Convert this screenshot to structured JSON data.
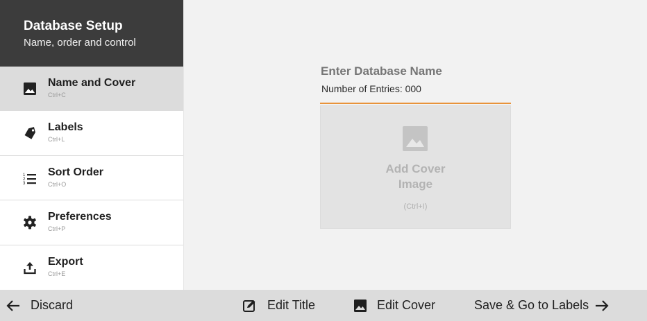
{
  "sidebar": {
    "title": "Database Setup",
    "subtitle": "Name, order and control",
    "items": [
      {
        "label": "Name and Cover",
        "shortcut": "Ctrl+C",
        "icon": "image-icon",
        "active": true
      },
      {
        "label": "Labels",
        "shortcut": "Ctrl+L",
        "icon": "tag-icon",
        "active": false
      },
      {
        "label": "Sort Order",
        "shortcut": "Ctrl+O",
        "icon": "numbered-list-icon",
        "active": false
      },
      {
        "label": "Preferences",
        "shortcut": "Ctrl+P",
        "icon": "gear-icon",
        "active": false
      },
      {
        "label": "Export",
        "shortcut": "Ctrl+E",
        "icon": "upload-icon",
        "active": false
      }
    ]
  },
  "main": {
    "name_placeholder": "Enter Database Name",
    "entries_label": "Number of Entries: 000",
    "cover": {
      "label": "Add Cover Image",
      "shortcut": "(Ctrl+I)",
      "icon": "image-icon"
    }
  },
  "bottom_bar": {
    "discard_label": "Discard",
    "edit_title_label": "Edit Title",
    "edit_cover_label": "Edit Cover",
    "save_label": "Save & Go to Labels"
  },
  "colors": {
    "header_bg": "#3c3c3c",
    "active_item_bg": "#dcdcdc",
    "accent_underline": "#e8933a",
    "bottom_bar_bg": "#dcdcdc",
    "content_bg": "#f2f2f2"
  }
}
